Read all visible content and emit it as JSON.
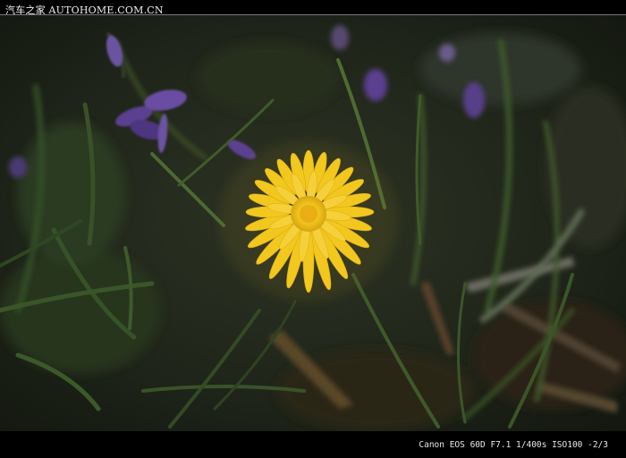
{
  "header": {
    "watermark_text": "汽车之家 AUTOHOME.COM.CN"
  },
  "footer": {
    "camera_info": "Canon EOS 60D F7.1 1/400s ISO100 -2/3"
  },
  "photo": {
    "subject": "yellow-dandelion",
    "colors": {
      "background": "#1d2118",
      "grass": "#3f5a2a",
      "petal": "#f2c81e",
      "petal_center": "#e8a90f",
      "violet": "#5a3f8f",
      "dry_leaf": "#5a4628"
    }
  }
}
